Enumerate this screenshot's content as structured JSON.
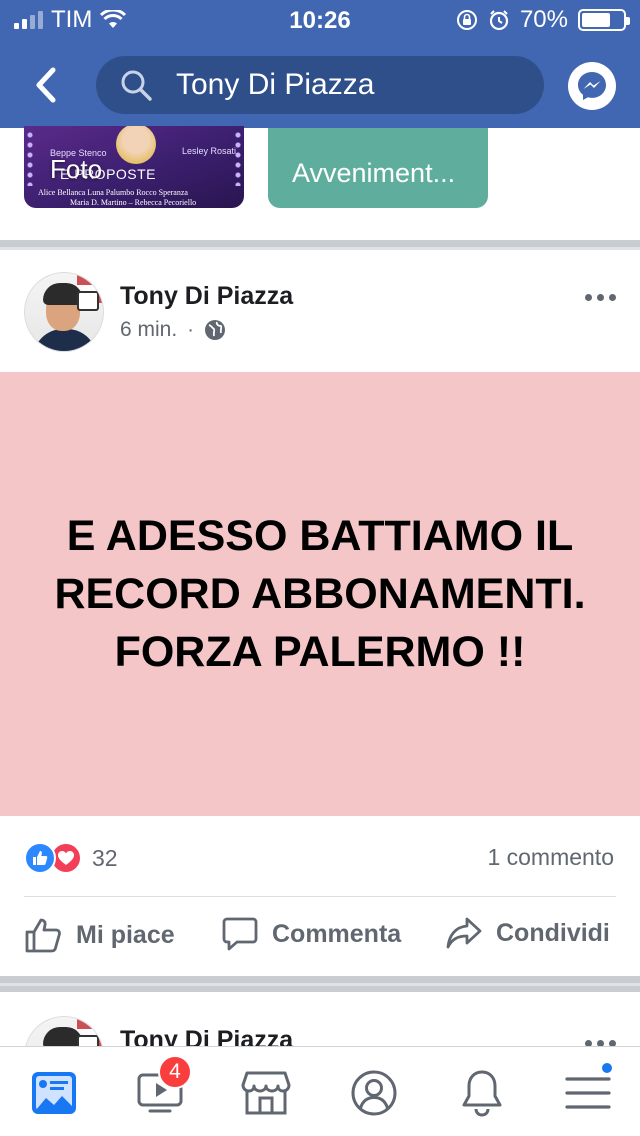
{
  "status_bar": {
    "carrier": "TIM",
    "time": "10:26",
    "battery_percent": "70%",
    "battery_level": 0.7
  },
  "header": {
    "search_text": "Tony Di Piazza",
    "back_icon": "chevron-left-icon",
    "search_icon": "search-icon",
    "messenger_icon": "messenger-icon",
    "color": "#4267b2"
  },
  "cards": {
    "foto_label": "Foto",
    "avvenimenti_label": "Avveniment...",
    "foto_image": {
      "caption_left": "Beppe Stenco",
      "caption_right": "Lesley Rosati",
      "banner": "E PROPOSTE",
      "names_line1": "Alice Bellanca    Luna Palumbo    Rocco Speranza",
      "names_line2": "Maria D. Martino – Rebecca Pecoriello"
    }
  },
  "post": {
    "author": "Tony Di Piazza",
    "time": "6 min.",
    "privacy_icon": "globe-icon",
    "text": "E ADESSO BATTIAMO IL RECORD ABBONAMENTI. FORZA PALERMO !!",
    "background_color": "#f4c6c8",
    "reactions_count": "32",
    "comments_count": "1 commento",
    "actions": {
      "like": "Mi piace",
      "comment": "Commenta",
      "share": "Condividi"
    }
  },
  "post2": {
    "author": "Tony Di Piazza"
  },
  "bottom_nav": {
    "items": [
      "news-feed-icon",
      "watch-icon",
      "marketplace-icon",
      "profile-icon",
      "notifications-icon",
      "menu-icon"
    ],
    "watch_badge": "4"
  }
}
